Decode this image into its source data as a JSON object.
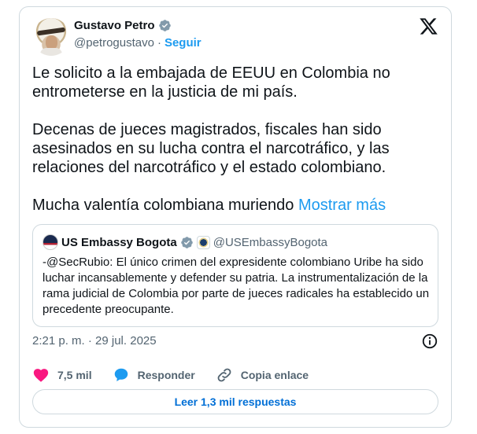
{
  "author": {
    "name": "Gustavo Petro",
    "handle": "@petrogustavo",
    "separator": "·",
    "follow_label": "Seguir"
  },
  "tweet": {
    "text": "Le solicito a la embajada de EEUU en Colombia no\nentrometerse en la justicia de mi país.\n\nDecenas de jueces magistrados, fiscales han sido\nasesinados en su lucha contra el narcotráfico, y las\nrelaciones del narcotráfico y el estado colombiano.\n\nMucha valentía colombiana muriendo ",
    "show_more": "Mostrar más"
  },
  "quote": {
    "name": "US Embassy Bogota",
    "handle": "@USEmbassyBogota",
    "text": "-@SecRubio: El único crimen del expresidente colombiano Uribe ha sido luchar incansablemente y defender su patria. La instrumentalización de la rama judicial de Colombia por parte de jueces radicales ha establecido un precedente preocupante."
  },
  "meta": {
    "timestamp": "2:21 p. m. · 29 jul. 2025"
  },
  "actions": {
    "likes": "7,5 mil",
    "reply_label": "Responder",
    "copy_link_label": "Copia enlace"
  },
  "replies_button": "Leer 1,3 mil respuestas",
  "colors": {
    "accent": "#1d9bf0",
    "like": "#f91880",
    "text": "#0f1419",
    "muted": "#536471",
    "border": "#cfd9de"
  },
  "icons": [
    "verified-badge-icon",
    "x-logo-icon",
    "info-icon",
    "heart-icon",
    "reply-bubble-icon",
    "link-icon"
  ]
}
